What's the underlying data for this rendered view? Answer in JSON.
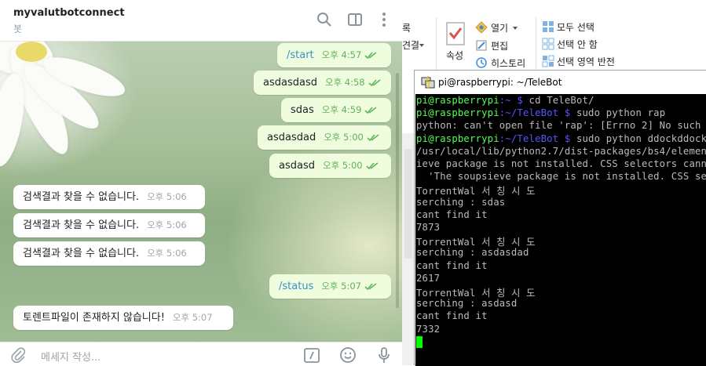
{
  "telegram": {
    "title": "myvalutbotconnect",
    "subtitle": "봇",
    "messages": [
      {
        "dir": "out",
        "text": "/start",
        "time": "오후 4:57",
        "cmd": true
      },
      {
        "dir": "out",
        "text": "asdasdasd",
        "time": "오후 4:58",
        "cmd": false
      },
      {
        "dir": "out",
        "text": "sdas",
        "time": "오후 4:59",
        "cmd": false
      },
      {
        "dir": "out",
        "text": "asdasdad",
        "time": "오후 5:00",
        "cmd": false
      },
      {
        "dir": "out",
        "text": "asdasd",
        "time": "오후 5:00",
        "cmd": false
      },
      {
        "dir": "in",
        "text": "검색결과 찾을 수 없습니다.",
        "time": "오후 5:06"
      },
      {
        "dir": "in",
        "text": "검색결과 찾을 수 없습니다.",
        "time": "오후 5:06"
      },
      {
        "dir": "in",
        "text": "검색결과 찾을 수 없습니다.",
        "time": "오후 5:06"
      },
      {
        "dir": "out",
        "text": "/status",
        "time": "오후 5:07",
        "cmd": true
      },
      {
        "dir": "in",
        "text": "토렌트파일이 존재하지 않습니다!",
        "time": "오후 5:07"
      }
    ],
    "input_placeholder": "메세지 작성...",
    "icons": [
      "search-icon",
      "sidebar-toggle-icon",
      "more-icon",
      "attach-icon",
      "commands-icon",
      "emoji-icon",
      "microphone-icon"
    ]
  },
  "ribbon": {
    "col1": [
      "록",
      "견결"
    ],
    "properties_label": "속성",
    "open_label": "열기",
    "edit_label": "편집",
    "history_label": "히스토리",
    "select_all": "모두 선택",
    "select_none": "선택 안 함",
    "invert_selection": "선택 영역 반전"
  },
  "putty": {
    "title": "pi@raspberrypi: ~/TeleBot",
    "lines": [
      [
        {
          "t": "pi@raspberrypi",
          "c": "g"
        },
        {
          "t": ":~ $ ",
          "c": "b"
        },
        {
          "t": "cd TeleBot/",
          "c": ""
        }
      ],
      [
        {
          "t": "pi@raspberrypi",
          "c": "g"
        },
        {
          "t": ":~/TeleBot $ ",
          "c": "b"
        },
        {
          "t": "sudo python rap",
          "c": ""
        }
      ],
      [
        {
          "t": "python: can't open file 'rap': [Errno 2] No such",
          "c": ""
        }
      ],
      [
        {
          "t": "pi@raspberrypi",
          "c": "g"
        },
        {
          "t": ":~/TeleBot $ ",
          "c": "b"
        },
        {
          "t": "sudo python ddockddock",
          "c": ""
        }
      ],
      [
        {
          "t": "/usr/local/lib/python2.7/dist-packages/bs4/elemen",
          "c": ""
        }
      ],
      [
        {
          "t": "ieve package is not installed. CSS selectors cann",
          "c": ""
        }
      ],
      [
        {
          "t": "  'The soupsieve package is not installed. CSS se",
          "c": ""
        }
      ],
      [
        {
          "t": "TorrentWal 서 칭 시 도",
          "c": ""
        }
      ],
      [
        {
          "t": "serching : sdas",
          "c": ""
        }
      ],
      [
        {
          "t": "cant find it",
          "c": ""
        }
      ],
      [
        {
          "t": "7873",
          "c": ""
        }
      ],
      [
        {
          "t": "TorrentWal 서 칭 시 도",
          "c": ""
        }
      ],
      [
        {
          "t": "serching : asdasdad",
          "c": ""
        }
      ],
      [
        {
          "t": "cant find it",
          "c": ""
        }
      ],
      [
        {
          "t": "2617",
          "c": ""
        }
      ],
      [
        {
          "t": "TorrentWal 서 칭 시 도",
          "c": ""
        }
      ],
      [
        {
          "t": "serching : asdasd",
          "c": ""
        }
      ],
      [
        {
          "t": "cant find it",
          "c": ""
        }
      ],
      [
        {
          "t": "7332",
          "c": ""
        }
      ]
    ]
  }
}
